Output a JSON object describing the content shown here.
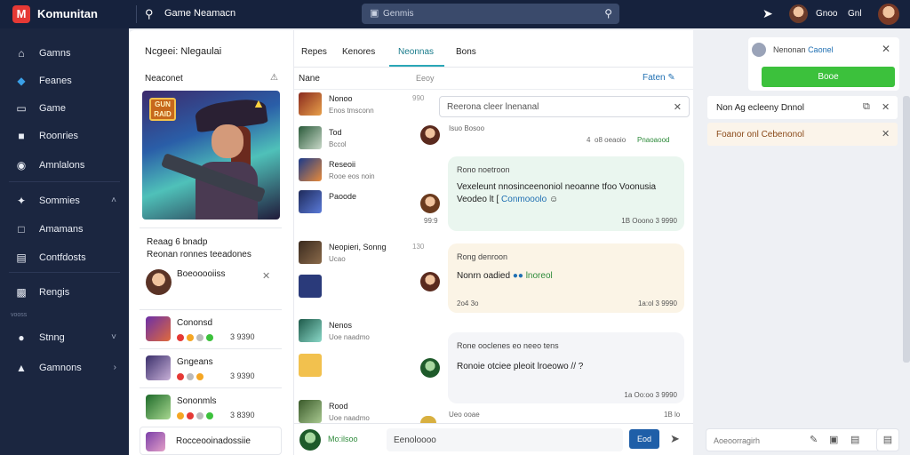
{
  "topbar": {
    "logo": "M",
    "brand": "Komunitan",
    "title": "Game Neamacn",
    "search_text": "Genmis",
    "user1": "Gnoo",
    "user2": "Gnl"
  },
  "sidebar": {
    "items": [
      {
        "label": "Gamns",
        "icon": "home-icon"
      },
      {
        "label": "Feanes",
        "icon": "diamond-icon"
      },
      {
        "label": "Game",
        "icon": "folder-icon"
      },
      {
        "label": "Roonries",
        "icon": "bag-icon"
      },
      {
        "label": "Amnlalons",
        "icon": "shield-icon"
      },
      {
        "label": "Sommies",
        "icon": "puzzle-icon"
      },
      {
        "label": "Amamans",
        "icon": "window-icon"
      },
      {
        "label": "Contfdosts",
        "icon": "list-icon"
      },
      {
        "label": "Rengis",
        "icon": "chart-icon"
      },
      {
        "label": "Stnng",
        "icon": "globe-icon"
      },
      {
        "label": "Gamnons",
        "icon": "gamepad-icon"
      }
    ],
    "section_label": "vooss"
  },
  "left_panel": {
    "header": "Ncgeei:  Nlegaulai",
    "subheader": "Neaconet",
    "badge_text": "GUN RAID",
    "info_title": "Reaag 6 bnadp",
    "info_sub": "Reonan  ronnes  teeadones",
    "info_user": "Boeooooiiss",
    "games": [
      {
        "name": "Cononsd",
        "pts": "3 9390"
      },
      {
        "name": "Gngeans",
        "pts": "3 9390"
      },
      {
        "name": "Sononmls",
        "pts": "3 8390"
      }
    ],
    "footer": "Rocceooinadossiie"
  },
  "center": {
    "tabs": [
      "Repes",
      "Kenores",
      "Neonnas",
      "Bons"
    ],
    "col_name": "Nane",
    "col_time": "Eeoy",
    "col_filter": "Faten",
    "players": [
      {
        "name": "Nonoo",
        "status": "Enos tmsconn",
        "time": "990"
      },
      {
        "name": "Tod",
        "status": "Bccol",
        "time": ""
      },
      {
        "name": "Reseoii",
        "status": "Rooe eos noin",
        "time": ""
      },
      {
        "name": "Paoode",
        "status": "",
        "time": ""
      },
      {
        "name": "Neopieri, Sonng",
        "status": "Ucao",
        "time": "130"
      },
      {
        "name": "",
        "status": "",
        "time": ""
      },
      {
        "name": "Nenos",
        "status": "Uoe naadmo",
        "time": ""
      },
      {
        "name": "",
        "status": "",
        "time": ""
      },
      {
        "name": "Rood",
        "status": "Uoe naadmo",
        "time": ""
      }
    ],
    "chat_search": "Reerona  cleer lnenanal",
    "meta1": {
      "label": "Isuo  Bosoo",
      "count": "4",
      "date": "o8 oeaoio",
      "tag": "Pnaoaood"
    },
    "bubble1": {
      "head": "Rono  noetroon",
      "body1": "Vexeleunt nnosinceenoniol neoanne tfoo Voonusia",
      "body2": "Veodeo  lt  [",
      "link": "Conmooolo",
      "foot": "1B  Ooono  3 9990"
    },
    "meta2_time": "99:9",
    "bubble2": {
      "head": "Rong  denroon",
      "body": "Nonrn oadied",
      "link": "lnoreol",
      "foot_l": "2o4  3o",
      "foot": "1a:ol  3 9990"
    },
    "bubble3": {
      "head": "Rone  ooclenes  eo neeo tens",
      "body": "Ronoie  otciee  pleoit  lroeowo   // ?",
      "foot": "1a  Oo:oo  3 9990"
    },
    "meta3": {
      "label": "Ueo  ooae",
      "time": "1B  lo"
    },
    "composer_name": "Mo:ilsoo",
    "composer_text": "Eenoloooo",
    "send_label": "Eod"
  },
  "right_panel": {
    "notif1_text": "Nenonan",
    "notif1_link": "Caonel",
    "notif1_button": "Booe",
    "notif2_text": "Non  Ag ecleeny  Dnnol",
    "notif3_text": "Foanor  onl  Cebenonol",
    "footer_text": "Aoeoorragirh"
  },
  "colors": {
    "topbar": "#16223d",
    "sidebar": "#1b2640",
    "accent": "#2aa7b7",
    "green": "#3cc13c",
    "send": "#1f5fa8"
  }
}
